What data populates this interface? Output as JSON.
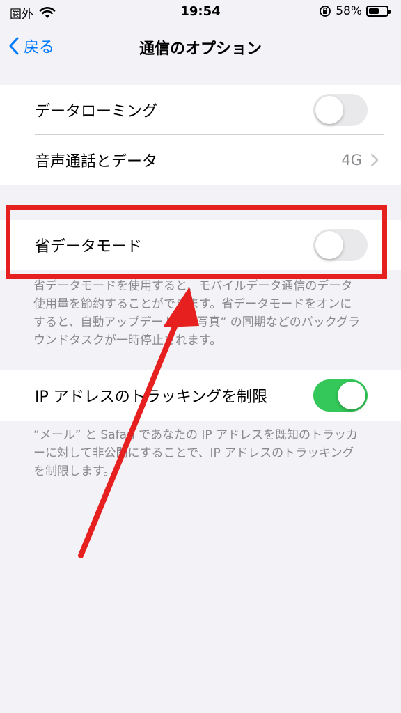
{
  "status_bar": {
    "carrier": "圏外",
    "time": "19:54",
    "battery_percent": "58%",
    "battery_level": 0.58
  },
  "nav": {
    "back_label": "戻る",
    "title": "通信のオプション"
  },
  "rows": {
    "data_roaming": {
      "label": "データローミング",
      "enabled": false
    },
    "voice_data": {
      "label": "音声通話とデータ",
      "value": "4G"
    },
    "low_data_mode": {
      "label": "省データモード",
      "enabled": false
    },
    "limit_ip_tracking": {
      "label": "IP アドレスのトラッキングを制限",
      "enabled": true
    }
  },
  "footnotes": {
    "low_data_mode": "省データモードを使用すると、モバイルデータ通信のデータ使用量を節約することができます。省データモードをオンにすると、自動アップデートや “写真” の同期などのバックグラウンドタスクが一時停止されます。",
    "ip_tracking": "“メール” と Safari であなたの IP アドレスを既知のトラッカーに対して非公開にすることで、IP アドレスのトラッキングを制限します。"
  },
  "colors": {
    "accent_blue": "#007aff",
    "toggle_on": "#34c759",
    "annotation_red": "#e61f1f"
  }
}
